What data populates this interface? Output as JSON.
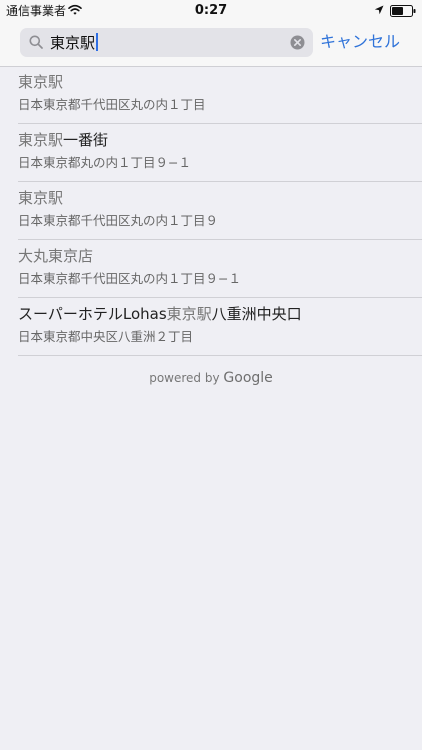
{
  "status_bar": {
    "carrier": "通信事業者",
    "time": "0:27",
    "icons": [
      "wifi-icon",
      "location-icon",
      "battery-icon"
    ]
  },
  "search": {
    "query": "東京駅",
    "cancel_label": "キャンセル",
    "icons": [
      "search-icon",
      "clear-icon"
    ]
  },
  "results": [
    {
      "title_match": "東京駅",
      "title_rest": "",
      "subtitle": "日本東京都千代田区丸の内１丁目"
    },
    {
      "title_match": "東京駅",
      "title_rest": "一番街",
      "subtitle": "日本東京都丸の内１丁目９−１"
    },
    {
      "title_match": "東京駅",
      "title_rest": "",
      "subtitle": "日本東京都千代田区丸の内１丁目９"
    },
    {
      "title_match": "大丸東京店",
      "title_rest": "",
      "subtitle": "日本東京都千代田区丸の内１丁目９−１"
    },
    {
      "title_prefix": "スーパーホテルLohas",
      "title_match": "東京駅",
      "title_rest": "八重洲中央口",
      "subtitle": "日本東京都中央区八重洲２丁目"
    }
  ],
  "footer": {
    "powered_prefix": "powered by",
    "brand": "Google"
  },
  "colors": {
    "accent": "#2f73d9",
    "background": "#efeff4"
  }
}
